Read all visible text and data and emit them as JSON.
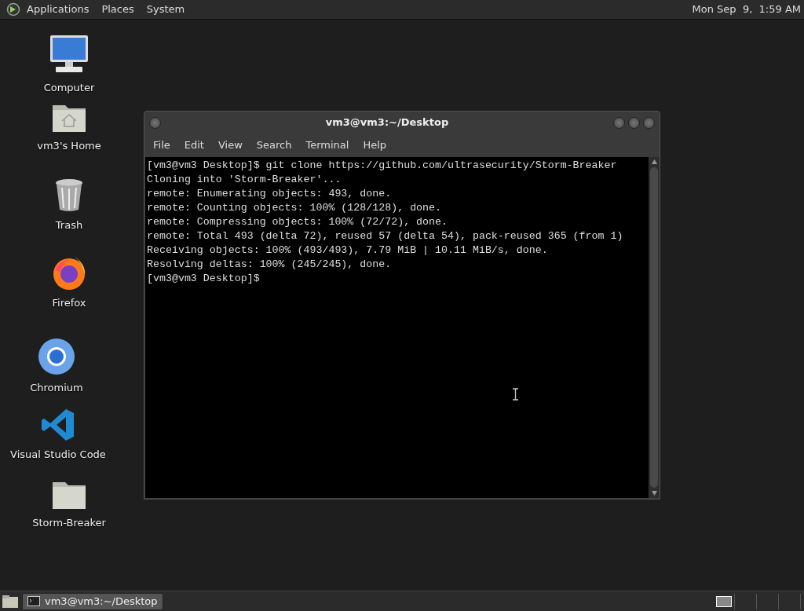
{
  "top_panel": {
    "menus": [
      "Applications",
      "Places",
      "System"
    ],
    "clock": "Mon Sep  9,  1:59 AM"
  },
  "desktop_icons": [
    {
      "label": "Computer",
      "kind": "computer"
    },
    {
      "label": "vm3's Home",
      "kind": "home"
    },
    {
      "label": "Trash",
      "kind": "trash"
    },
    {
      "label": "Firefox",
      "kind": "firefox"
    },
    {
      "label": "Chromium",
      "kind": "chromium"
    },
    {
      "label": "Visual Studio Code",
      "kind": "vscode"
    },
    {
      "label": "Storm-Breaker",
      "kind": "folder"
    }
  ],
  "terminal_window": {
    "title": "vm3@vm3:~/Desktop",
    "menus": [
      "File",
      "Edit",
      "View",
      "Search",
      "Terminal",
      "Help"
    ],
    "lines": [
      "[vm3@vm3 Desktop]$ git clone https://github.com/ultrasecurity/Storm-Breaker",
      "Cloning into 'Storm-Breaker'...",
      "remote: Enumerating objects: 493, done.",
      "remote: Counting objects: 100% (128/128), done.",
      "remote: Compressing objects: 100% (72/72), done.",
      "remote: Total 493 (delta 72), reused 57 (delta 54), pack-reused 365 (from 1)",
      "Receiving objects: 100% (493/493), 7.79 MiB | 10.11 MiB/s, done.",
      "Resolving deltas: 100% (245/245), done.",
      "[vm3@vm3 Desktop]$"
    ]
  },
  "bottom_panel": {
    "tasks": [
      {
        "label": "vm3@vm3:~/Desktop",
        "selected": true
      }
    ],
    "workspaces": [
      {
        "selected": true
      },
      {
        "selected": false
      },
      {
        "selected": false
      },
      {
        "selected": false
      }
    ]
  }
}
